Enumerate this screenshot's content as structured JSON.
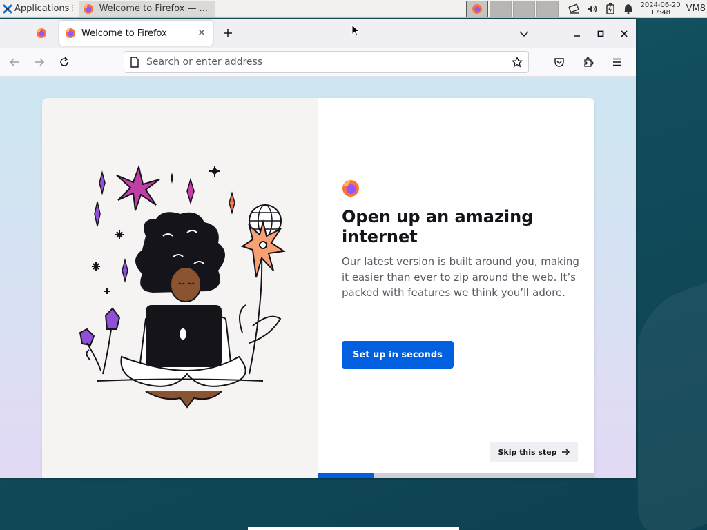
{
  "panel": {
    "applications_label": "Applications",
    "task_title": "Welcome to Firefox — ...",
    "clock_date": "2024-06-20",
    "clock_time": "17:48",
    "vm_label": "VM8"
  },
  "browser": {
    "tab_title": "Welcome to Firefox",
    "url_placeholder": "Search or enter address",
    "url_value": ""
  },
  "onboarding": {
    "headline": "Open up an amazing internet",
    "body": "Our latest version is built around you, making it easier than ever to zip around the web. It’s packed with features we think you’ll adore.",
    "primary_button": "Set up in seconds",
    "skip_button": "Skip this step",
    "progress": 0.2
  },
  "colors": {
    "accent": "#0060df",
    "firefox_orange": "#ff7139",
    "firefox_purple": "#9059ff"
  }
}
